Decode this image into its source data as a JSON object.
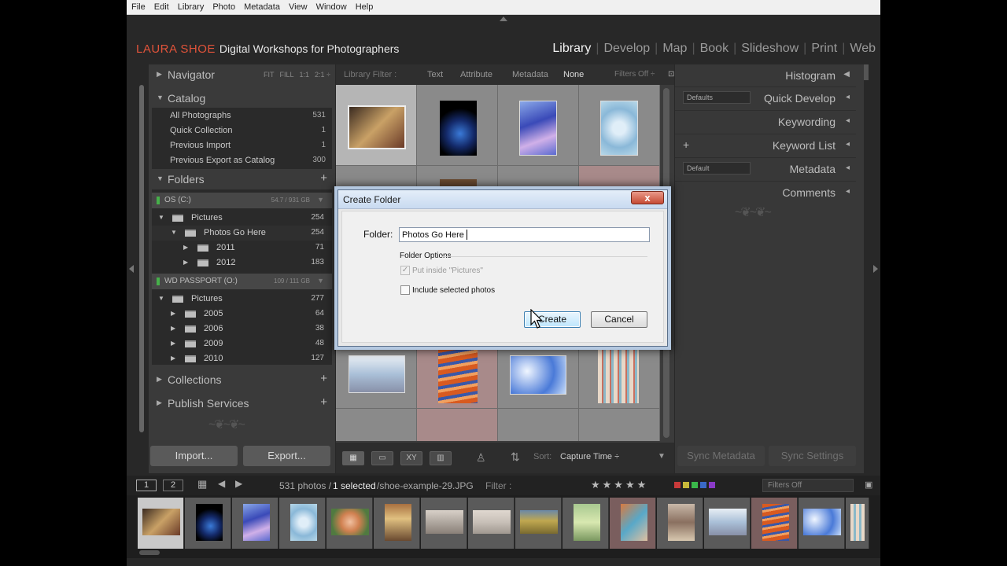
{
  "menubar": [
    "File",
    "Edit",
    "Library",
    "Photo",
    "Metadata",
    "View",
    "Window",
    "Help"
  ],
  "identity": {
    "brand": "LAURA SHOE",
    "tagline": "Digital Workshops for Photographers"
  },
  "modules": {
    "library": "Library",
    "develop": "Develop",
    "map": "Map",
    "book": "Book",
    "slideshow": "Slideshow",
    "print": "Print",
    "web": "Web"
  },
  "navigator": {
    "title": "Navigator",
    "fit": "FIT",
    "fill": "FILL",
    "one": "1:1",
    "ratio": "2:1 ÷"
  },
  "catalog": {
    "title": "Catalog",
    "items": [
      {
        "label": "All Photographs",
        "count": "531"
      },
      {
        "label": "Quick Collection",
        "count": "1"
      },
      {
        "label": "Previous Import",
        "count": "1"
      },
      {
        "label": "Previous Export as Catalog",
        "count": "300"
      }
    ]
  },
  "folders": {
    "title": "Folders",
    "plus": "+",
    "volume1": {
      "name": "OS (C:)",
      "size": "54.7 / 931 GB"
    },
    "volume1_items": [
      {
        "name": "Pictures",
        "count": "254"
      },
      {
        "name": "Photos Go Here",
        "count": "254"
      },
      {
        "name": "2011",
        "count": "71"
      },
      {
        "name": "2012",
        "count": "183"
      }
    ],
    "volume2": {
      "name": "WD PASSPORT (O:)",
      "size": "109 / 111 GB"
    },
    "volume2_items": [
      {
        "name": "Pictures",
        "count": "277"
      },
      {
        "name": "2005",
        "count": "64"
      },
      {
        "name": "2006",
        "count": "38"
      },
      {
        "name": "2009",
        "count": "48"
      },
      {
        "name": "2010",
        "count": "127"
      }
    ]
  },
  "collections": {
    "title": "Collections",
    "plus": "+"
  },
  "publish": {
    "title": "Publish Services",
    "plus": "+"
  },
  "left_buttons": {
    "import": "Import...",
    "export": "Export..."
  },
  "filterbar": {
    "label": "Library Filter :",
    "text": "Text",
    "attribute": "Attribute",
    "metadata": "Metadata",
    "none": "None",
    "filters_off": "Filters Off ÷"
  },
  "toolbar": {
    "sort_label": "Sort:",
    "sort_value": "Capture Time ÷"
  },
  "right_panel": {
    "histogram": "Histogram",
    "quick_develop": "Quick Develop",
    "quick_develop_preset": "Defaults",
    "keywording": "Keywording",
    "keyword_list": "Keyword List",
    "keyword_plus": "+",
    "metadata": "Metadata",
    "metadata_preset": "Default",
    "comments": "Comments"
  },
  "right_buttons": {
    "sync_metadata": "Sync Metadata",
    "sync_settings": "Sync Settings"
  },
  "filmstrip_bar": {
    "page1": "1",
    "page2": "2",
    "count": "531 photos /",
    "selected": "1 selected",
    "file": "/shoe-example-29.JPG",
    "filter_label": "Filter :",
    "filter_value": "Filters Off"
  },
  "dialog": {
    "title": "Create Folder",
    "folder_label": "Folder:",
    "folder_value": "Photos Go Here",
    "options_title": "Folder Options",
    "put_inside": "Put inside \"Pictures\"",
    "include_selected": "Include selected photos",
    "create": "Create",
    "cancel": "Cancel",
    "close": "x"
  },
  "colors": {
    "brand": "#e0533a",
    "panel": "#3a3a3a",
    "dialog_border": "#5a6f8a",
    "dialog_accent": "#3c7fb1"
  }
}
